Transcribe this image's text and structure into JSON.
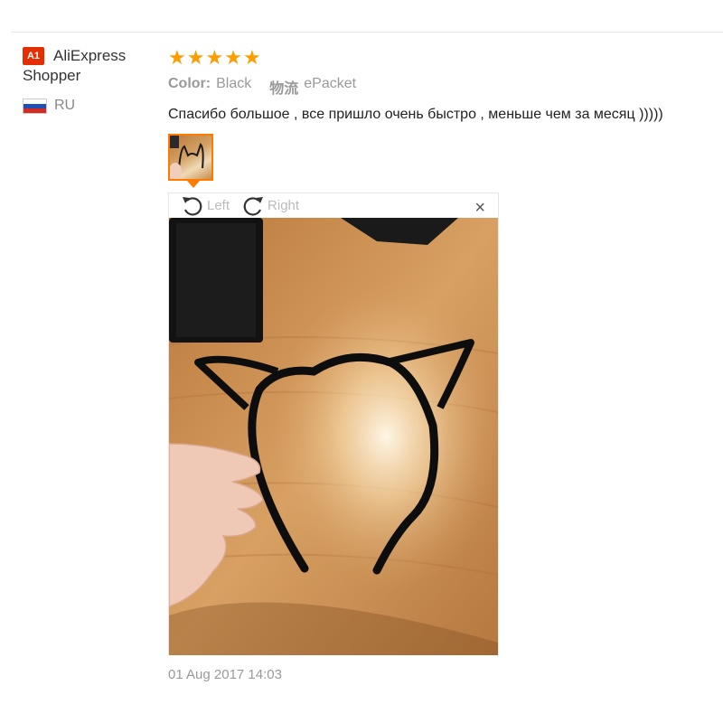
{
  "user": {
    "badge": "A1",
    "name_line1": "AliExpress",
    "name_line2": "Shopper",
    "country": "RU"
  },
  "review": {
    "rating": 5,
    "stars": [
      "★",
      "★",
      "★",
      "★",
      "★"
    ],
    "color_label": "Color:",
    "color_value": "Black",
    "shipping_label": "物流",
    "shipping_value": "ePacket",
    "text": "Спасибо большое , все пришло очень быстро , меньше чем за месяц )))))",
    "date": "01 Aug 2017 14:03"
  },
  "viewer": {
    "rotate_left_label": "Left",
    "rotate_right_label": "Right",
    "close_glyph": "×"
  },
  "colors": {
    "star": "#ff9c00",
    "badge": "#e62e04",
    "thumb_border": "#ff7a00",
    "muted_text": "#999999",
    "wood": "#d3955a"
  },
  "icons": [
    "rotate-left-icon",
    "rotate-right-icon",
    "close-icon",
    "russia-flag-icon",
    "a1-badge-icon"
  ]
}
